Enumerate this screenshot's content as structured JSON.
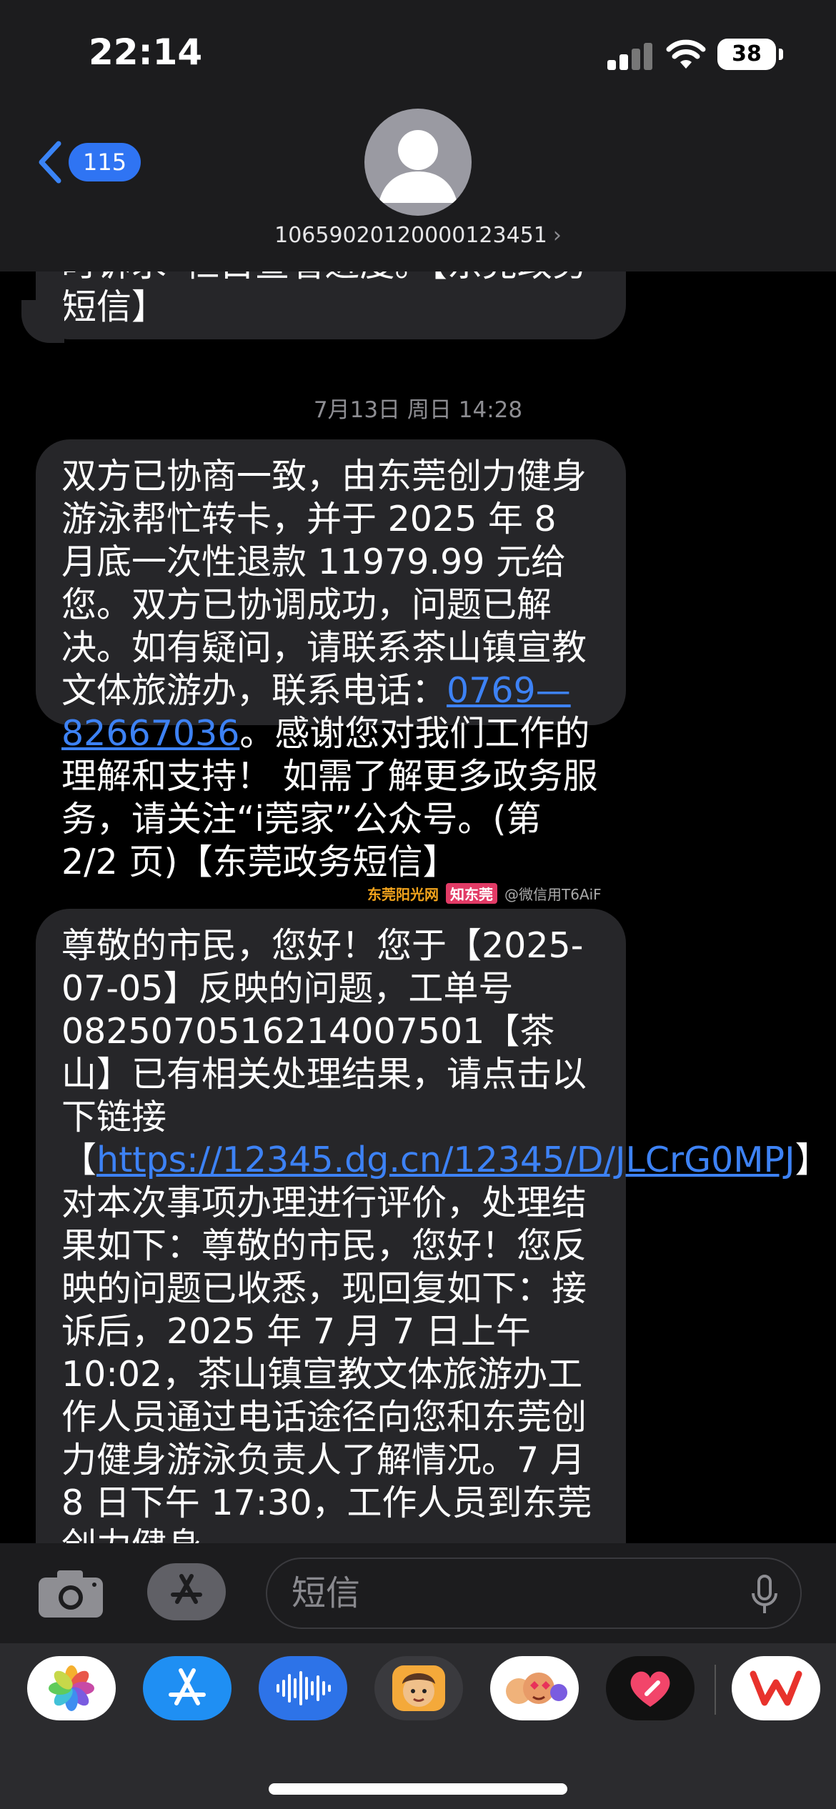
{
  "status": {
    "time": "22:14",
    "battery": "38"
  },
  "header": {
    "back_count": "115",
    "contact_number": "10659020120000123451",
    "contact_chevron": "›"
  },
  "messages": {
    "partial_top": "时诉求”栏目查看进度。【东莞政务短信】",
    "timestamp": "7月13日 周日 14:28",
    "msg1": {
      "part1": "双方已协商一致，由东莞创力健身游泳帮忙转卡，并于 2025 年 8 月底一次性退款 11979.99 元给您。双方已协调成功，问题已解决。如有疑问，请联系茶山镇宣教文体旅游办，联系电话：",
      "phone_link": "0769—82667036",
      "part2": "。感谢您对我们工作的理解和支持！ 如需了解更多政务服务，请关注“i莞家”公众号。(第 2/2 页)【东莞政务短信】"
    },
    "msg2": {
      "part1": "尊敬的市民，您好！您于【2025-07-05】反映的问题，工单号 08250705162140075​01【茶山】已有相关处理结果，请点击以下链接【",
      "url_link": "https://12345.dg.cn/12345/D/JLCrG0MPJ",
      "part2": "】 对本次事项办理进行评价，处理结果如下：尊敬的市民，您好！您反映的问题已收悉，现回复如下：接诉后，2025 年 7 月 7 日上午 10:02，茶山镇宣教文体旅游办工作人员通过电话途径向您和东莞创力健身游泳负责人了解情况。7 月 8 日下午 17:30，工作人员到东莞创力健身"
    },
    "watermark": {
      "site1": "东莞阳光网",
      "site2": "知东莞",
      "handle": "@微信用T6AiF"
    }
  },
  "input": {
    "placeholder": "短信"
  },
  "drawer": {
    "apps": [
      "photos-app",
      "app-store-app",
      "audio-app",
      "memoji-app",
      "memoji-stickers-app",
      "digital-touch-app",
      "wps-app"
    ]
  },
  "colors": {
    "link": "#3d82f5",
    "bubble": "#262629",
    "badge": "#2f74f3",
    "bar": "#1c1c1e"
  }
}
